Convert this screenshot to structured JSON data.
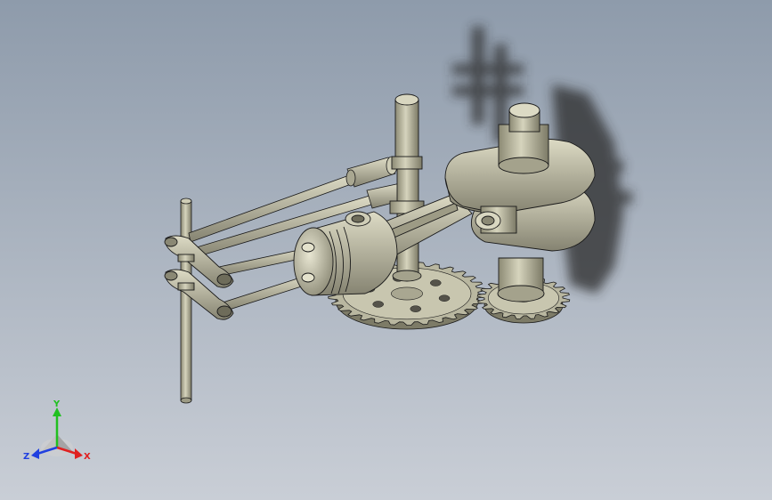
{
  "viewport": {
    "background_top": "#8e9bab",
    "background_bottom": "#c9ced6",
    "model_color": "#b5b39c",
    "edge_color": "#1a1a1a"
  },
  "triad": {
    "x_label": "X",
    "y_label": "Y",
    "z_label": "Z",
    "x_color": "#e02020",
    "y_color": "#20c020",
    "z_color": "#2040e0"
  }
}
